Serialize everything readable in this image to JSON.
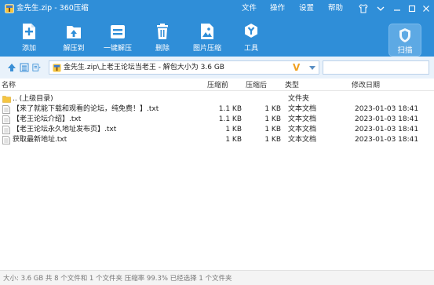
{
  "titlebar": {
    "title": "金先生.zip - 360压缩",
    "menu": [
      "文件",
      "操作",
      "设置",
      "帮助"
    ]
  },
  "toolbar": {
    "tools": [
      {
        "label": "添加",
        "icon": "add-icon"
      },
      {
        "label": "解压到",
        "icon": "extract-to-icon"
      },
      {
        "label": "一键解压",
        "icon": "one-click-extract-icon"
      },
      {
        "label": "删除",
        "icon": "delete-icon"
      },
      {
        "label": "图片压缩",
        "icon": "image-compress-icon"
      },
      {
        "label": "工具",
        "icon": "tools-icon"
      }
    ],
    "scan_label": "扫描"
  },
  "address": {
    "path": "金先生.zip\\上老王论坛当老王 - 解包大小为 3.6 GB",
    "v_badge": "V"
  },
  "columns": {
    "name": "名称",
    "compressed": "压缩前",
    "original": "压缩后",
    "type": "类型",
    "modified": "修改日期"
  },
  "files": [
    {
      "name": ".. (上级目录)",
      "compressed": "",
      "original": "",
      "type": "文件夹",
      "modified": "",
      "icon": "folder-icon"
    },
    {
      "name": "【来了就能下载和观看的论坛，纯免费！】.txt",
      "compressed": "1.1 KB",
      "original": "1 KB",
      "type": "文本文档",
      "modified": "2023-01-03 18:41",
      "icon": "text-file-icon"
    },
    {
      "name": "【老王论坛介绍】.txt",
      "compressed": "1.1 KB",
      "original": "1 KB",
      "type": "文本文档",
      "modified": "2023-01-03 18:41",
      "icon": "text-file-icon"
    },
    {
      "name": "【老王论坛永久地址发布页】.txt",
      "compressed": "1 KB",
      "original": "1 KB",
      "type": "文本文档",
      "modified": "2023-01-03 18:41",
      "icon": "text-file-icon"
    },
    {
      "name": "获取最新地址.txt",
      "compressed": "1 KB",
      "original": "1 KB",
      "type": "文本文档",
      "modified": "2023-01-03 18:41",
      "icon": "text-file-icon"
    }
  ],
  "status": {
    "text": "大小: 3.6 GB 共 8 个文件和 1 个文件夹 压缩率 99.3% 已经选择 1 个文件夹"
  },
  "colors": {
    "accent": "#2f8ed8",
    "address_bg": "#e9f2fb"
  }
}
